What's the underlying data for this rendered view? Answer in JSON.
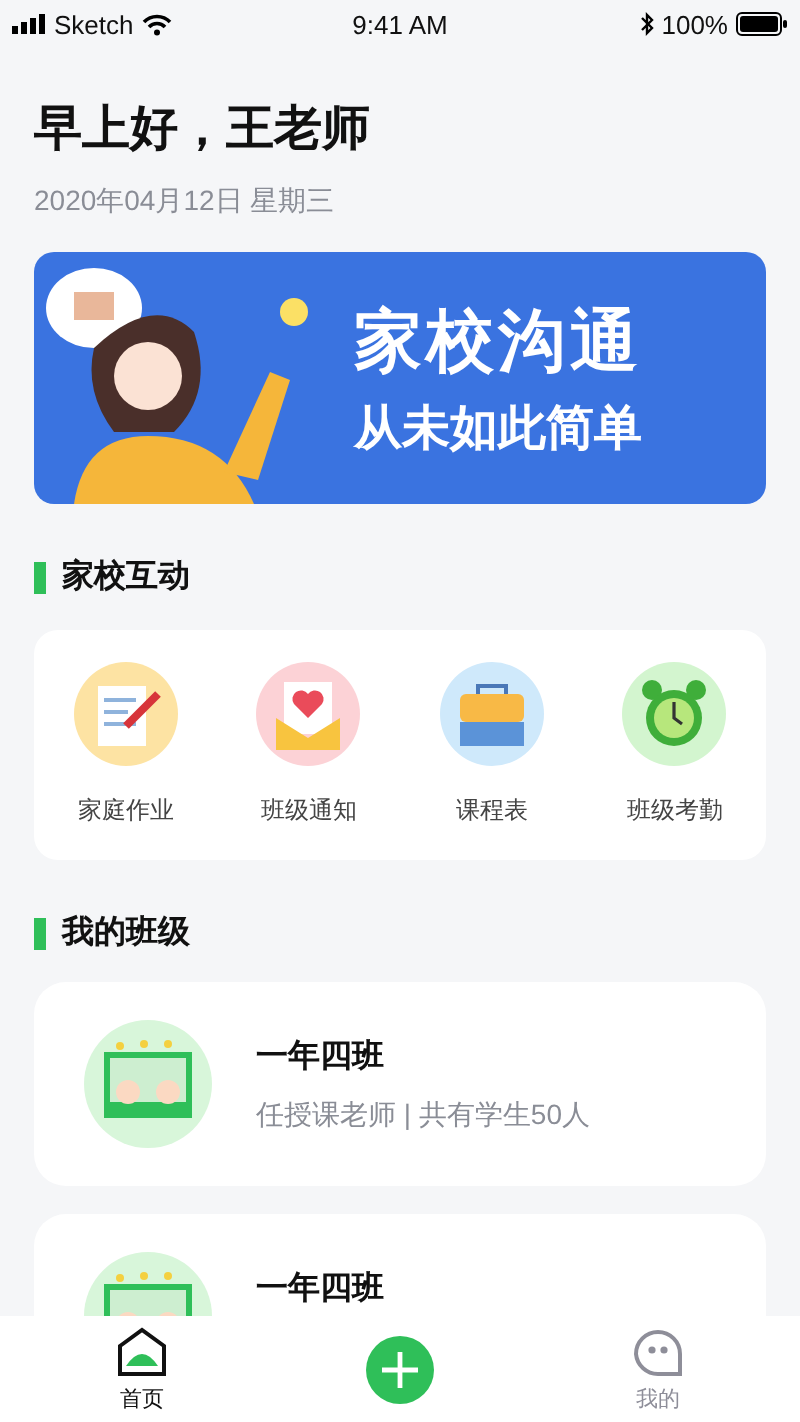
{
  "status_bar": {
    "carrier": "Sketch",
    "time": "9:41 AM",
    "battery": "100%"
  },
  "greeting": "早上好，王老师",
  "date": "2020年04月12日 星期三",
  "banner": {
    "title": "家校沟通",
    "subtitle": "从未如此简单"
  },
  "sections": [
    {
      "title": "家校互动"
    },
    {
      "title": "我的班级"
    }
  ],
  "shortcuts": [
    {
      "label": "家庭作业",
      "kind": "homework"
    },
    {
      "label": "班级通知",
      "kind": "notice"
    },
    {
      "label": "课程表",
      "kind": "schedule"
    },
    {
      "label": "班级考勤",
      "kind": "attendance"
    }
  ],
  "classes": [
    {
      "name": "一年四班",
      "info": "任授课老师 | 共有学生50人"
    },
    {
      "name": "一年四班"
    }
  ],
  "tab_bar": [
    {
      "kind": "tab",
      "label": "首页",
      "selected": true
    },
    {
      "kind": "add"
    },
    {
      "kind": "tab",
      "label": "我的",
      "selected": false
    }
  ]
}
